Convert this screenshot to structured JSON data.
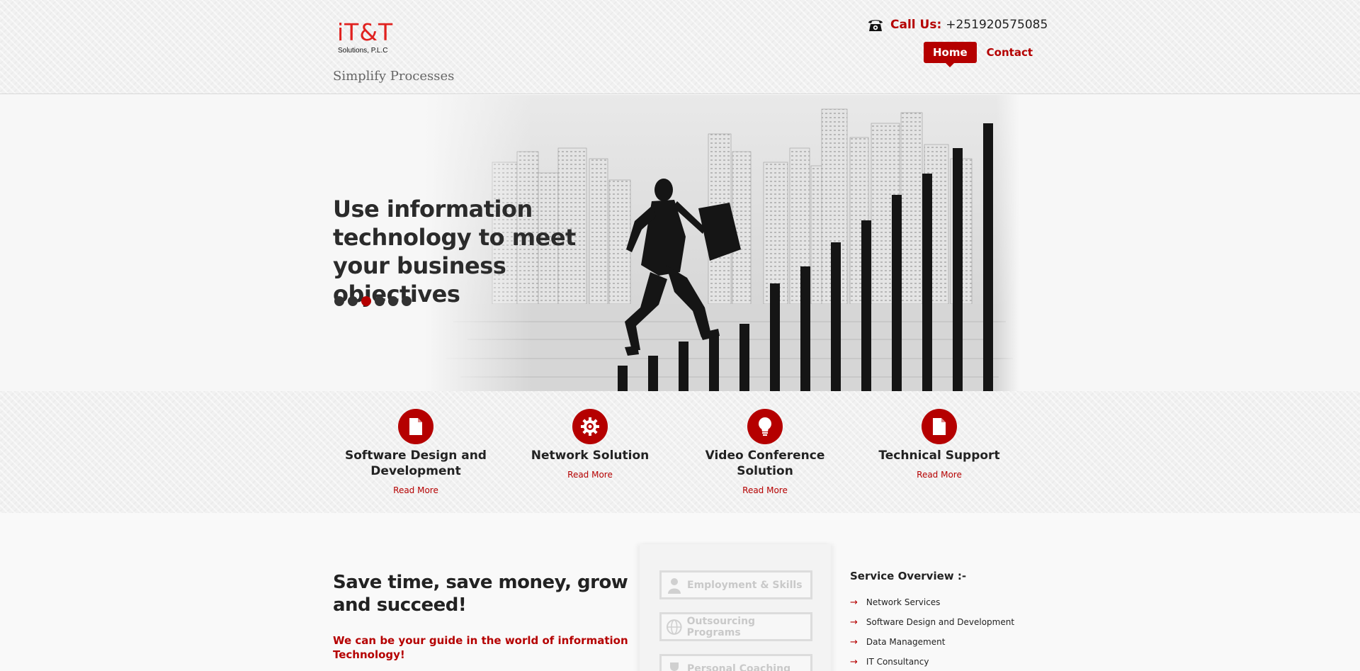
{
  "header": {
    "logo_main": "iT&T",
    "logo_sub": "Solutions, P.L.C",
    "tagline": "Simplify Processes",
    "phone_label": "Call Us:",
    "phone_number": "+251920575085",
    "nav": {
      "home": "Home",
      "contact": "Contact"
    }
  },
  "hero": {
    "title": "Use information technology to meet your business objectives",
    "slides_count": 6,
    "active_slide": 3
  },
  "services": [
    {
      "title": "Software Design and Development",
      "link": "Read More",
      "icon": "document-icon"
    },
    {
      "title": "Network Solution",
      "link": "Read More",
      "icon": "gear-icon"
    },
    {
      "title": "Video Conference Solution",
      "link": "Read More",
      "icon": "lightbulb-icon"
    },
    {
      "title": "Technical Support",
      "link": "Read More",
      "icon": "document-icon"
    }
  ],
  "lower": {
    "title": "Save time, save money, grow and succeed!",
    "subtitle": "We can be your guide in the world of information Technology!",
    "programs": [
      {
        "label": "Employment & Skills",
        "icon": "person-icon"
      },
      {
        "label": "Outsourcing Programs",
        "icon": "globe-icon"
      },
      {
        "label": "Personal Coaching",
        "icon": "trophy-icon"
      }
    ],
    "overview_title": "Service Overview :-",
    "overview_items": [
      "Network Services",
      "Software Design and Development",
      "Data Management",
      "IT Consultancy"
    ]
  },
  "colors": {
    "brand_red": "#b50000",
    "logo_red": "#e0211f",
    "text_dark": "#222222"
  }
}
